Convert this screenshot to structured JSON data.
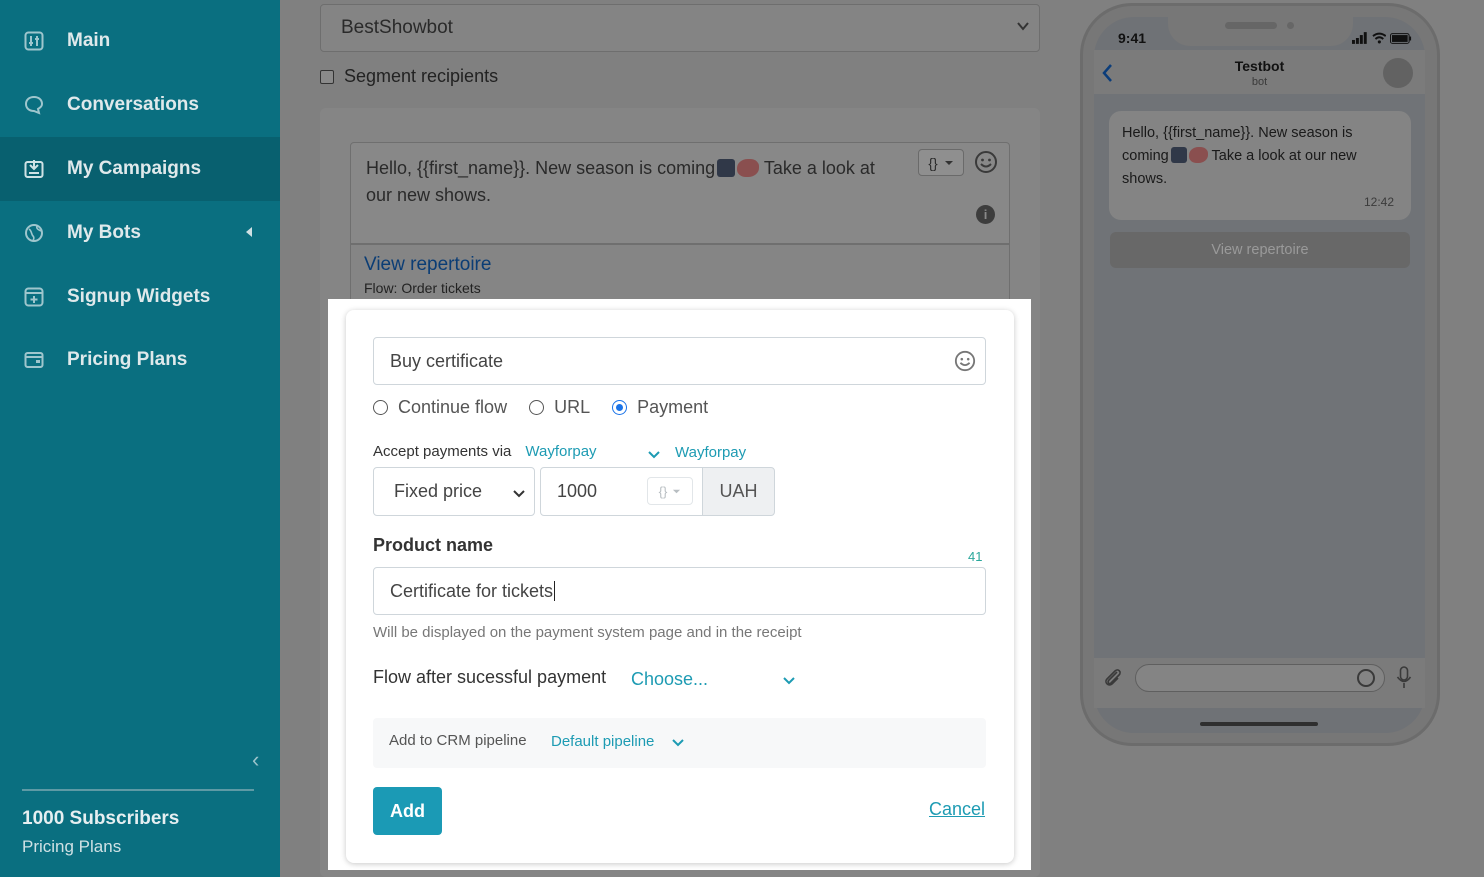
{
  "sidebar": {
    "items": [
      {
        "label": "Main",
        "icon": "equalizer-icon"
      },
      {
        "label": "Conversations",
        "icon": "chat-bubble-icon"
      },
      {
        "label": "My Campaigns",
        "icon": "campaign-icon",
        "active": true
      },
      {
        "label": "My Bots",
        "icon": "globe-icon"
      },
      {
        "label": "Signup Widgets",
        "icon": "widget-plus-icon"
      },
      {
        "label": "Pricing Plans",
        "icon": "wallet-icon"
      }
    ],
    "subscribers": "1000 Subscribers",
    "plan_link": "Pricing Plans"
  },
  "campaign": {
    "bot_select": "BestShowbot",
    "segment_label": "Segment recipients",
    "message_part1": "Hello,  {{first_name}}. New season is coming",
    "message_part2": " Take a look at our new shows.",
    "button_link": "View repertoire",
    "button_flow": "Flow: Order tickets"
  },
  "phone": {
    "time": "9:41",
    "bot_name": "Testbot",
    "bot_sub": "bot",
    "message_part1": "Hello,  {{first_name}}. New season is coming",
    "message_part2": " Take a look at our new shows.",
    "message_time": "12:42",
    "button": "View repertoire"
  },
  "modal": {
    "button_text": "Buy certificate",
    "radio_options": [
      {
        "label": "Continue flow",
        "checked": false
      },
      {
        "label": "URL",
        "checked": false
      },
      {
        "label": "Payment",
        "checked": true
      }
    ],
    "accept_label": "Accept payments via",
    "accept_provider": "Wayforpay",
    "accept_provider_2": "Wayforpay",
    "price_type": "Fixed price",
    "price_value": "1000",
    "currency": "UAH",
    "product_name_label": "Product name",
    "product_name_counter": "41",
    "product_name_value": "Certificate for tickets",
    "product_name_hint": "Will be displayed on the payment system page and in the receipt",
    "flow_label": "Flow after sucessful payment",
    "flow_choose": "Choose...",
    "crm_label": "Add to CRM pipeline",
    "crm_value": "Default pipeline",
    "add_button": "Add",
    "cancel_link": "Cancel"
  },
  "colors": {
    "sidebar_bg": "#0a6f80",
    "accent": "#1b9ab5",
    "link": "#1d9bb3",
    "radio_checked": "#1a73e8"
  }
}
